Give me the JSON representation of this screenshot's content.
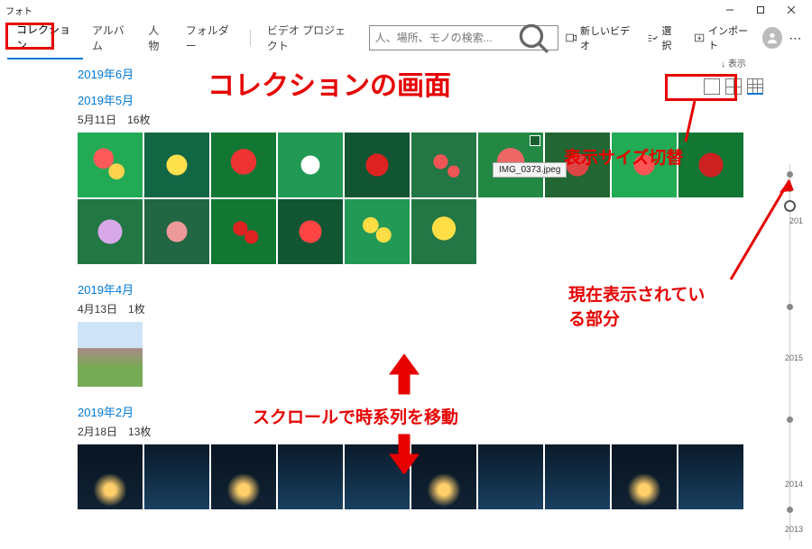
{
  "window": {
    "title": "フォト"
  },
  "tabs": {
    "collection": "コレクション",
    "album": "アルバム",
    "people": "人物",
    "folder": "フォルダー",
    "video": "ビデオ プロジェクト"
  },
  "search": {
    "placeholder": "人、場所、モノの検索..."
  },
  "toolbar": {
    "new_video": "新しいビデオ",
    "select": "選択",
    "import": "インポート"
  },
  "view": {
    "label": "↓  表示"
  },
  "tooltip": {
    "filename": "IMG_0373.jpeg"
  },
  "months": {
    "jun2019": "2019年6月",
    "may2019": "2019年5月",
    "may_sub": "5月11日　16枚",
    "apr2019": "2019年4月",
    "apr_sub": "4月13日　1枚",
    "feb2019": "2019年2月",
    "feb_sub": "2月18日　13枚"
  },
  "timeline": {
    "y201": "201",
    "y2015": "2015",
    "y2014": "2014",
    "y2013": "2013"
  },
  "annotations": {
    "title": "コレクションの画面",
    "size_switch": "表示サイズ切替",
    "current_view": "現在表示されている部分",
    "scroll": "スクロールで時系列を移動"
  }
}
